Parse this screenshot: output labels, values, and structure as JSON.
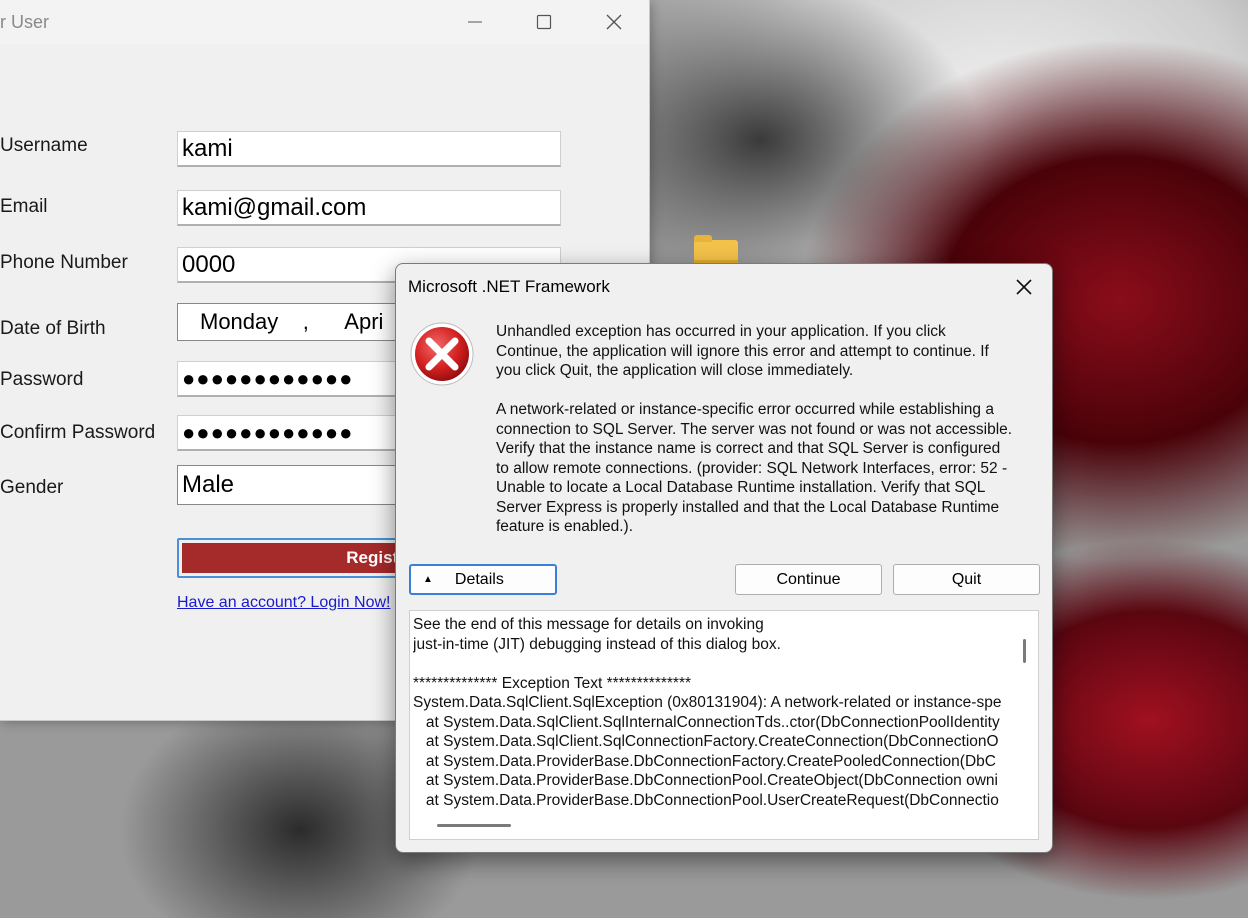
{
  "register_window": {
    "title": "r User",
    "fields": {
      "username_label": "Username",
      "username_value": "kami",
      "email_label": "Email",
      "email_value": "kami@gmail.com",
      "phone_label": "Phone Number",
      "phone_value": "0000",
      "dob_label": "Date of Birth",
      "dob_value": "Monday    ,      Apri",
      "password_label": "Password",
      "password_value": "●●●●●●●●●●●●",
      "confirm_password_label": "Confirm Password",
      "confirm_password_value": "●●●●●●●●●●●●",
      "gender_label": "Gender",
      "gender_value": "Male"
    },
    "register_button_label": "Registe",
    "login_link": "Have an account? Login Now!"
  },
  "dialog": {
    "title": "Microsoft .NET Framework",
    "message_1": "Unhandled exception has occurred in your application. If you click Continue, the application will ignore this error and attempt to continue. If you click Quit, the application will close immediately.",
    "message_2": "A network-related or instance-specific error occurred while establishing a connection to SQL Server. The server was not found or was not accessible. Verify that the instance name is correct and that SQL Server is configured to allow remote connections. (provider: SQL Network Interfaces, error: 52 - Unable to locate a Local Database Runtime installation. Verify that SQL Server Express is properly installed and that the Local Database Runtime feature is enabled.).",
    "details_label": "Details",
    "continue_label": "Continue",
    "quit_label": "Quit",
    "details_text": "See the end of this message for details on invoking\njust-in-time (JIT) debugging instead of this dialog box.\n\n************** Exception Text **************\nSystem.Data.SqlClient.SqlException (0x80131904): A network-related or instance-spe\n   at System.Data.SqlClient.SqlInternalConnectionTds..ctor(DbConnectionPoolIdentity\n   at System.Data.SqlClient.SqlConnectionFactory.CreateConnection(DbConnectionO\n   at System.Data.ProviderBase.DbConnectionFactory.CreatePooledConnection(DbC\n   at System.Data.ProviderBase.DbConnectionPool.CreateObject(DbConnection owni\n   at System.Data.ProviderBase.DbConnectionPool.UserCreateRequest(DbConnectio"
  },
  "icons": {
    "error": "error-icon",
    "close": "close-icon",
    "minimize": "minimize-icon",
    "maximize": "maximize-icon",
    "folder": "folder-icon"
  },
  "colors": {
    "register_button": "#a52a2a",
    "focus_border": "#3c7fd6",
    "link": "#1a1acd"
  }
}
